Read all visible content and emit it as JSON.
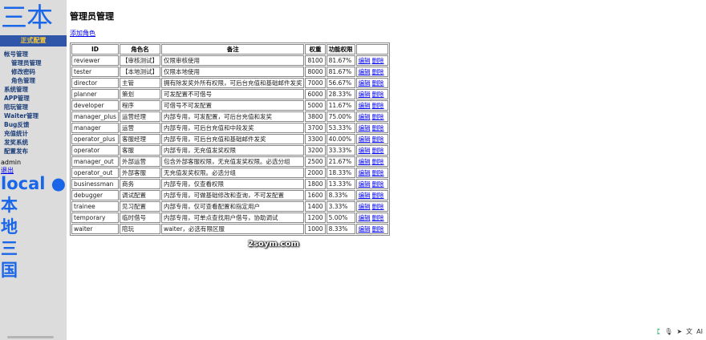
{
  "sidebar": {
    "brand": "三本",
    "env_badge": "正式配置",
    "menu": [
      {
        "label": "帐号管理",
        "sub": false
      },
      {
        "label": "管理员管理",
        "sub": true
      },
      {
        "label": "修改密码",
        "sub": true
      },
      {
        "label": "角色管理",
        "sub": true
      },
      {
        "label": "系统管理",
        "sub": false
      },
      {
        "label": "APP管理",
        "sub": false
      },
      {
        "label": "陪玩管理",
        "sub": false
      },
      {
        "label": "Waiter管理",
        "sub": false
      },
      {
        "label": "Bug反馈",
        "sub": false
      },
      {
        "label": "充值统计",
        "sub": false
      },
      {
        "label": "发奖系统",
        "sub": false
      },
      {
        "label": "配置发布",
        "sub": false
      }
    ],
    "user_name": "admin",
    "logout_label": "退出",
    "env_name": [
      "local ●",
      "本",
      "地",
      "三",
      "国"
    ]
  },
  "main": {
    "title": "管理员管理",
    "add_role_label": "添加角色",
    "table": {
      "headers": [
        "ID",
        "角色名",
        "备注",
        "权重",
        "功能权限",
        ""
      ],
      "edit_label": "编辑",
      "delete_label": "删除",
      "rows": [
        {
          "id": "reviewer",
          "name": "【审核测试】",
          "note": "仅限审核使用",
          "weight": "8100",
          "perm": "81.67%"
        },
        {
          "id": "tester",
          "name": "【本地测试】",
          "note": "仅限本地使用",
          "weight": "8000",
          "perm": "81.67%"
        },
        {
          "id": "director",
          "name": "主管",
          "note": "拥有除发奖外所有权限，可后台充值和基础邮件发奖",
          "weight": "7000",
          "perm": "56.67%"
        },
        {
          "id": "planner",
          "name": "策划",
          "note": "可发配置不可借号",
          "weight": "6000",
          "perm": "28.33%"
        },
        {
          "id": "developer",
          "name": "程序",
          "note": "可借号不可发配置",
          "weight": "5000",
          "perm": "11.67%"
        },
        {
          "id": "manager_plus",
          "name": "运营经理",
          "note": "内部专用，可发配置，可后台充值和发奖",
          "weight": "3800",
          "perm": "75.00%"
        },
        {
          "id": "manager",
          "name": "运营",
          "note": "内部专用，可后台充值和中段发奖",
          "weight": "3700",
          "perm": "53.33%"
        },
        {
          "id": "operator_plus",
          "name": "客服经理",
          "note": "内部专用，可后台充值和基础邮件发奖",
          "weight": "3300",
          "perm": "40.00%"
        },
        {
          "id": "operator",
          "name": "客服",
          "note": "内部专用，无充值发奖权限",
          "weight": "3200",
          "perm": "33.33%"
        },
        {
          "id": "manager_out",
          "name": "外部运营",
          "note": "包含外部客服权限，无充值发奖权限。必选分组",
          "weight": "2500",
          "perm": "21.67%"
        },
        {
          "id": "operator_out",
          "name": "外部客服",
          "note": "无充值发奖权限。必选分组",
          "weight": "2000",
          "perm": "18.33%"
        },
        {
          "id": "businessman",
          "name": "商务",
          "note": "内部专用，仅查看权限",
          "weight": "1800",
          "perm": "13.33%"
        },
        {
          "id": "debugger",
          "name": "调试配置",
          "note": "内部专用，可做基础修改和查询，不可发配置",
          "weight": "1600",
          "perm": "8.33%"
        },
        {
          "id": "trainee",
          "name": "见习配置",
          "note": "内部专用，仅可查看配置和指定用户",
          "weight": "1400",
          "perm": "3.33%"
        },
        {
          "id": "temporary",
          "name": "临时借号",
          "note": "内部专用，可单点查找用户借号，协助调试",
          "weight": "1200",
          "perm": "5.00%"
        },
        {
          "id": "waiter",
          "name": "陪玩",
          "note": "waiter，必选有限区服",
          "weight": "1000",
          "perm": "8.33%"
        }
      ]
    },
    "watermark": "2soym.com"
  },
  "tray": {
    "icons": [
      {
        "name": "brand-logo-icon",
        "glyph": "ᛈ"
      },
      {
        "name": "microphone-icon",
        "glyph": "🎙"
      },
      {
        "name": "send-icon",
        "glyph": "➤"
      },
      {
        "name": "translate-icon",
        "glyph": "文"
      },
      {
        "name": "ai-icon",
        "glyph": "AI"
      }
    ]
  }
}
